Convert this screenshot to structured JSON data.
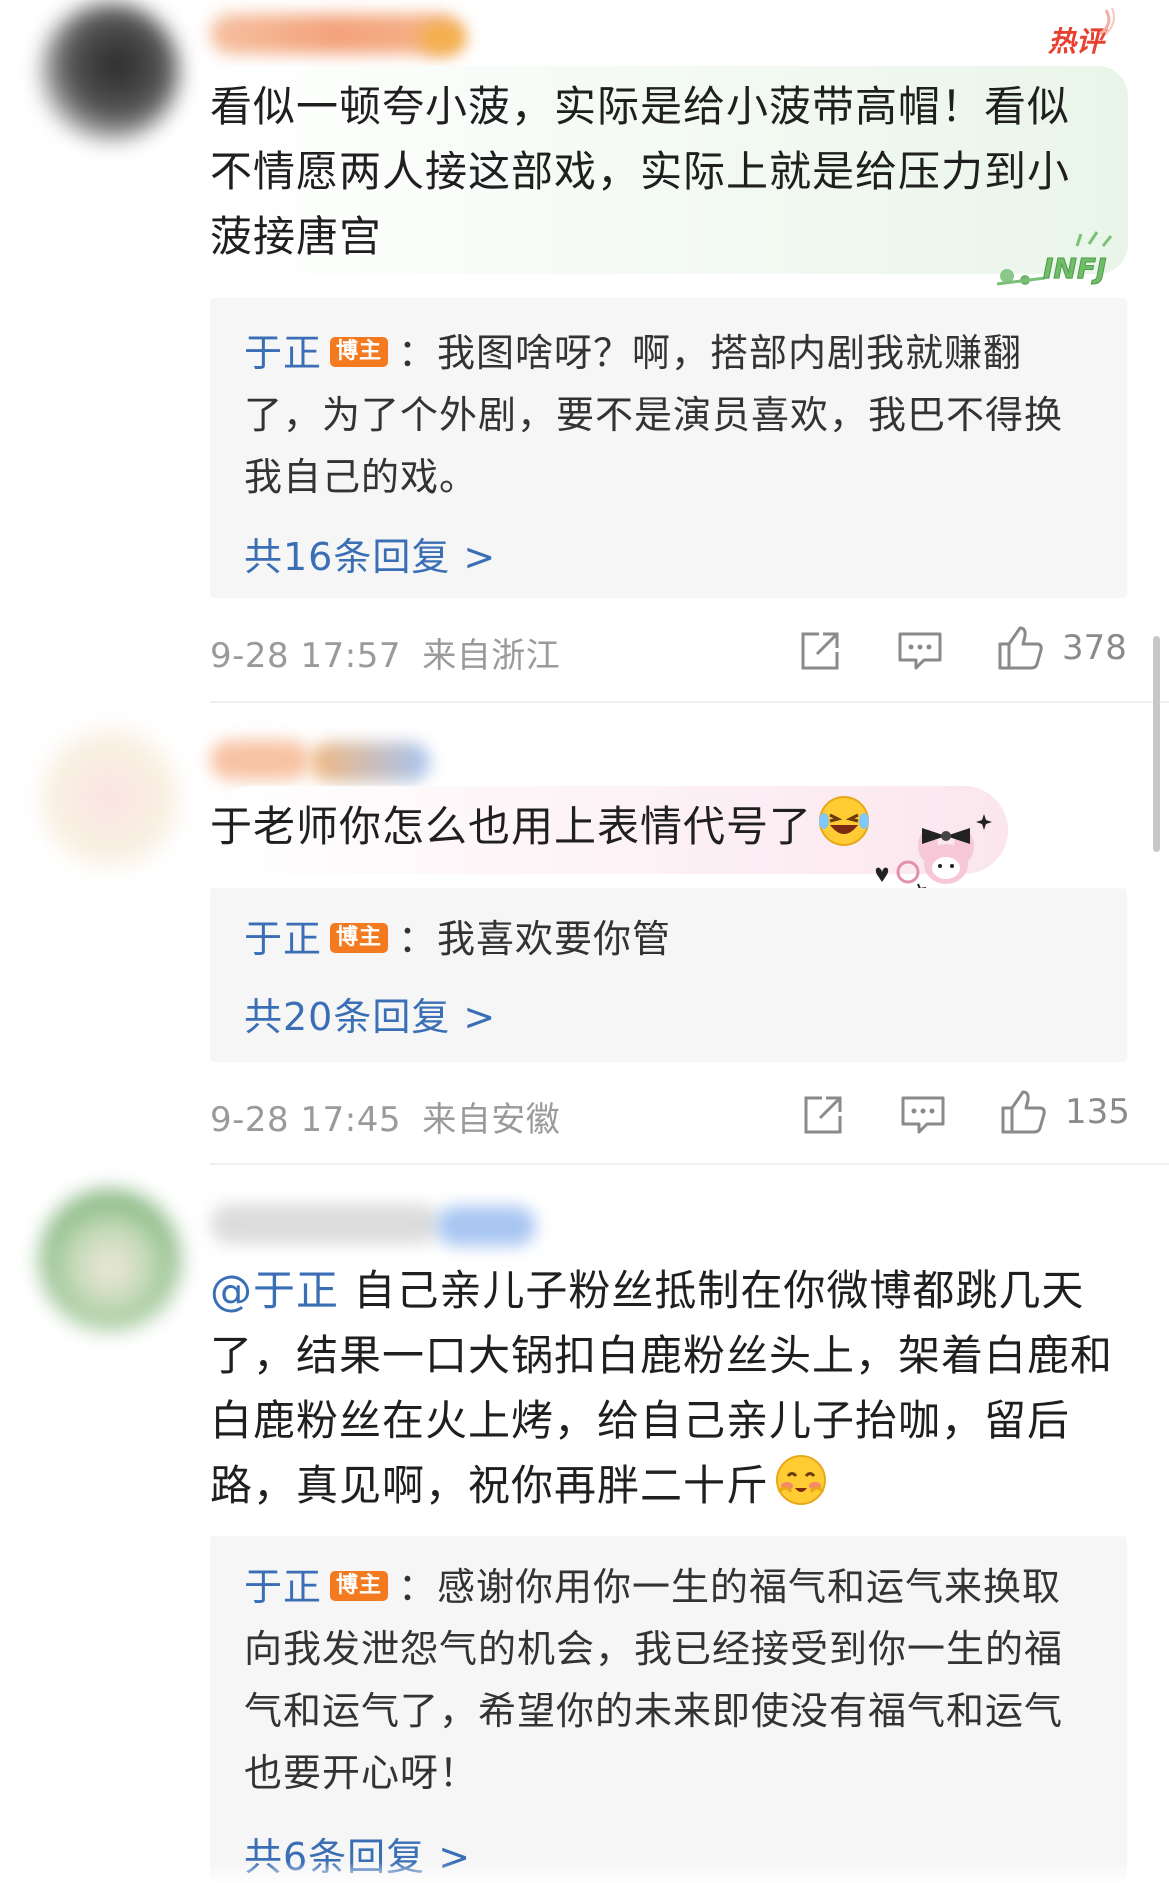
{
  "hot_tag": "热评",
  "comments": [
    {
      "text": "看似一顿夸小菠，实际是给小菠带高帽！看似不情愿两人接这部戏，实际上就是给压力到小菠接唐宫",
      "sticker_text": "INFJ",
      "reply": {
        "author": "于正",
        "badge": "博主",
        "text": "：我图啥呀？啊，搭部内剧我就赚翻了，为了个外剧，要不是演员喜欢，我巴不得换我自己的戏。",
        "more": "共16条回复 >"
      },
      "time": "9-28 17:57",
      "location": "来自浙江",
      "likes": "378"
    },
    {
      "text": "于老师你怎么也用上表情代号了",
      "reply": {
        "author": "于正",
        "badge": "博主",
        "text": "：我喜欢要你管",
        "more": "共20条回复 >"
      },
      "time": "9-28 17:45",
      "location": "来自安徽",
      "likes": "135"
    },
    {
      "mention": "@于正",
      "text": " 自己亲儿子粉丝抵制在你微博都跳几天了，结果一口大锅扣白鹿粉丝头上，架着白鹿和白鹿粉丝在火上烤，给自己亲儿子抬咖，留后路，真见啊，祝你再胖二十斤",
      "reply": {
        "author": "于正",
        "badge": "博主",
        "text": "：感谢你用你一生的福气和运气来换取向我发泄怨气的机会，我已经接受到你一生的福气和运气了，希望你的未来即使没有福气和运气也要开心呀！",
        "more": "共6条回复 >"
      }
    }
  ],
  "colors": {
    "link": "#3a6fb5",
    "badge": "#f47a20",
    "hot": "#e8402f",
    "reply_bg": "#f6f6f6"
  },
  "icons": [
    "share-icon",
    "comment-icon",
    "like-icon"
  ]
}
